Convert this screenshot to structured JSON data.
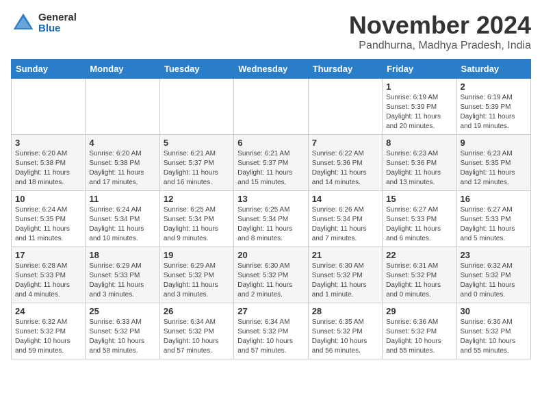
{
  "logo": {
    "general": "General",
    "blue": "Blue"
  },
  "title": {
    "month": "November 2024",
    "location": "Pandhurna, Madhya Pradesh, India"
  },
  "weekdays": [
    "Sunday",
    "Monday",
    "Tuesday",
    "Wednesday",
    "Thursday",
    "Friday",
    "Saturday"
  ],
  "weeks": [
    [
      {
        "day": "",
        "info": ""
      },
      {
        "day": "",
        "info": ""
      },
      {
        "day": "",
        "info": ""
      },
      {
        "day": "",
        "info": ""
      },
      {
        "day": "",
        "info": ""
      },
      {
        "day": "1",
        "info": "Sunrise: 6:19 AM\nSunset: 5:39 PM\nDaylight: 11 hours and 20 minutes."
      },
      {
        "day": "2",
        "info": "Sunrise: 6:19 AM\nSunset: 5:39 PM\nDaylight: 11 hours and 19 minutes."
      }
    ],
    [
      {
        "day": "3",
        "info": "Sunrise: 6:20 AM\nSunset: 5:38 PM\nDaylight: 11 hours and 18 minutes."
      },
      {
        "day": "4",
        "info": "Sunrise: 6:20 AM\nSunset: 5:38 PM\nDaylight: 11 hours and 17 minutes."
      },
      {
        "day": "5",
        "info": "Sunrise: 6:21 AM\nSunset: 5:37 PM\nDaylight: 11 hours and 16 minutes."
      },
      {
        "day": "6",
        "info": "Sunrise: 6:21 AM\nSunset: 5:37 PM\nDaylight: 11 hours and 15 minutes."
      },
      {
        "day": "7",
        "info": "Sunrise: 6:22 AM\nSunset: 5:36 PM\nDaylight: 11 hours and 14 minutes."
      },
      {
        "day": "8",
        "info": "Sunrise: 6:23 AM\nSunset: 5:36 PM\nDaylight: 11 hours and 13 minutes."
      },
      {
        "day": "9",
        "info": "Sunrise: 6:23 AM\nSunset: 5:35 PM\nDaylight: 11 hours and 12 minutes."
      }
    ],
    [
      {
        "day": "10",
        "info": "Sunrise: 6:24 AM\nSunset: 5:35 PM\nDaylight: 11 hours and 11 minutes."
      },
      {
        "day": "11",
        "info": "Sunrise: 6:24 AM\nSunset: 5:34 PM\nDaylight: 11 hours and 10 minutes."
      },
      {
        "day": "12",
        "info": "Sunrise: 6:25 AM\nSunset: 5:34 PM\nDaylight: 11 hours and 9 minutes."
      },
      {
        "day": "13",
        "info": "Sunrise: 6:25 AM\nSunset: 5:34 PM\nDaylight: 11 hours and 8 minutes."
      },
      {
        "day": "14",
        "info": "Sunrise: 6:26 AM\nSunset: 5:34 PM\nDaylight: 11 hours and 7 minutes."
      },
      {
        "day": "15",
        "info": "Sunrise: 6:27 AM\nSunset: 5:33 PM\nDaylight: 11 hours and 6 minutes."
      },
      {
        "day": "16",
        "info": "Sunrise: 6:27 AM\nSunset: 5:33 PM\nDaylight: 11 hours and 5 minutes."
      }
    ],
    [
      {
        "day": "17",
        "info": "Sunrise: 6:28 AM\nSunset: 5:33 PM\nDaylight: 11 hours and 4 minutes."
      },
      {
        "day": "18",
        "info": "Sunrise: 6:29 AM\nSunset: 5:33 PM\nDaylight: 11 hours and 3 minutes."
      },
      {
        "day": "19",
        "info": "Sunrise: 6:29 AM\nSunset: 5:32 PM\nDaylight: 11 hours and 3 minutes."
      },
      {
        "day": "20",
        "info": "Sunrise: 6:30 AM\nSunset: 5:32 PM\nDaylight: 11 hours and 2 minutes."
      },
      {
        "day": "21",
        "info": "Sunrise: 6:30 AM\nSunset: 5:32 PM\nDaylight: 11 hours and 1 minute."
      },
      {
        "day": "22",
        "info": "Sunrise: 6:31 AM\nSunset: 5:32 PM\nDaylight: 11 hours and 0 minutes."
      },
      {
        "day": "23",
        "info": "Sunrise: 6:32 AM\nSunset: 5:32 PM\nDaylight: 11 hours and 0 minutes."
      }
    ],
    [
      {
        "day": "24",
        "info": "Sunrise: 6:32 AM\nSunset: 5:32 PM\nDaylight: 10 hours and 59 minutes."
      },
      {
        "day": "25",
        "info": "Sunrise: 6:33 AM\nSunset: 5:32 PM\nDaylight: 10 hours and 58 minutes."
      },
      {
        "day": "26",
        "info": "Sunrise: 6:34 AM\nSunset: 5:32 PM\nDaylight: 10 hours and 57 minutes."
      },
      {
        "day": "27",
        "info": "Sunrise: 6:34 AM\nSunset: 5:32 PM\nDaylight: 10 hours and 57 minutes."
      },
      {
        "day": "28",
        "info": "Sunrise: 6:35 AM\nSunset: 5:32 PM\nDaylight: 10 hours and 56 minutes."
      },
      {
        "day": "29",
        "info": "Sunrise: 6:36 AM\nSunset: 5:32 PM\nDaylight: 10 hours and 55 minutes."
      },
      {
        "day": "30",
        "info": "Sunrise: 6:36 AM\nSunset: 5:32 PM\nDaylight: 10 hours and 55 minutes."
      }
    ]
  ]
}
